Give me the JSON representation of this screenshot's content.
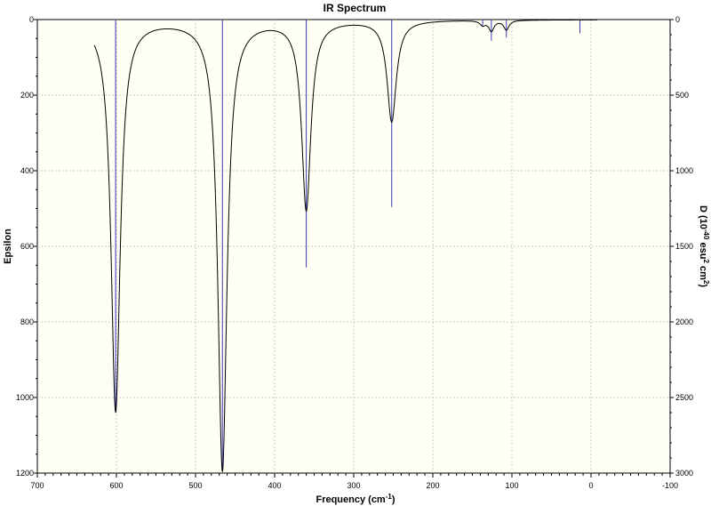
{
  "chart_data": {
    "type": "line",
    "title": "IR Spectrum",
    "xlabel": "Frequency (cm",
    "xlabel_sup": "-1",
    "xlabel_end": ")",
    "ylabel": "Epsilon",
    "y2label_parts": [
      "D (10",
      "-40",
      " esu",
      "2",
      " cm",
      "2",
      ")"
    ],
    "xlim": [
      700,
      -100
    ],
    "ylim": [
      1200,
      0
    ],
    "y2lim": [
      3000,
      0
    ],
    "grid": true,
    "x_ticks": [
      700,
      600,
      500,
      400,
      300,
      200,
      100,
      0,
      -100
    ],
    "y_ticks": [
      0,
      200,
      400,
      600,
      800,
      1000,
      1200
    ],
    "y2_ticks": [
      0,
      500,
      1000,
      1500,
      2000,
      2500,
      3000
    ],
    "x_tick_labels": [
      "700",
      "600",
      "500",
      "400",
      "300",
      "200",
      "100",
      "0",
      "-100"
    ],
    "y_tick_labels": [
      "0",
      "200",
      "400",
      "600",
      "800",
      "1000",
      "1200"
    ],
    "y2_tick_labels": [
      "0",
      "500",
      "1000",
      "1500",
      "2000",
      "2500",
      "3000"
    ],
    "spectrum_range": [
      628,
      -8
    ],
    "peaks": [
      {
        "freq": 601,
        "epsilon": 1035,
        "intensity": 2600
      },
      {
        "freq": 466,
        "epsilon": 1190,
        "intensity": 2980
      },
      {
        "freq": 360,
        "epsilon": 500,
        "intensity": 1640
      },
      {
        "freq": 252,
        "epsilon": 268,
        "intensity": 1240
      },
      {
        "freq": 137,
        "epsilon": 12,
        "intensity": 45
      },
      {
        "freq": 126,
        "epsilon": 28,
        "intensity": 140
      },
      {
        "freq": 107,
        "epsilon": 25,
        "intensity": 120
      },
      {
        "freq": 14,
        "epsilon": 0,
        "intensity": 90
      }
    ],
    "colors": {
      "background": "#fffff5",
      "spectrum": "#000000",
      "sticks": "#3a3ab4",
      "grid": "#c8c8c8"
    }
  }
}
